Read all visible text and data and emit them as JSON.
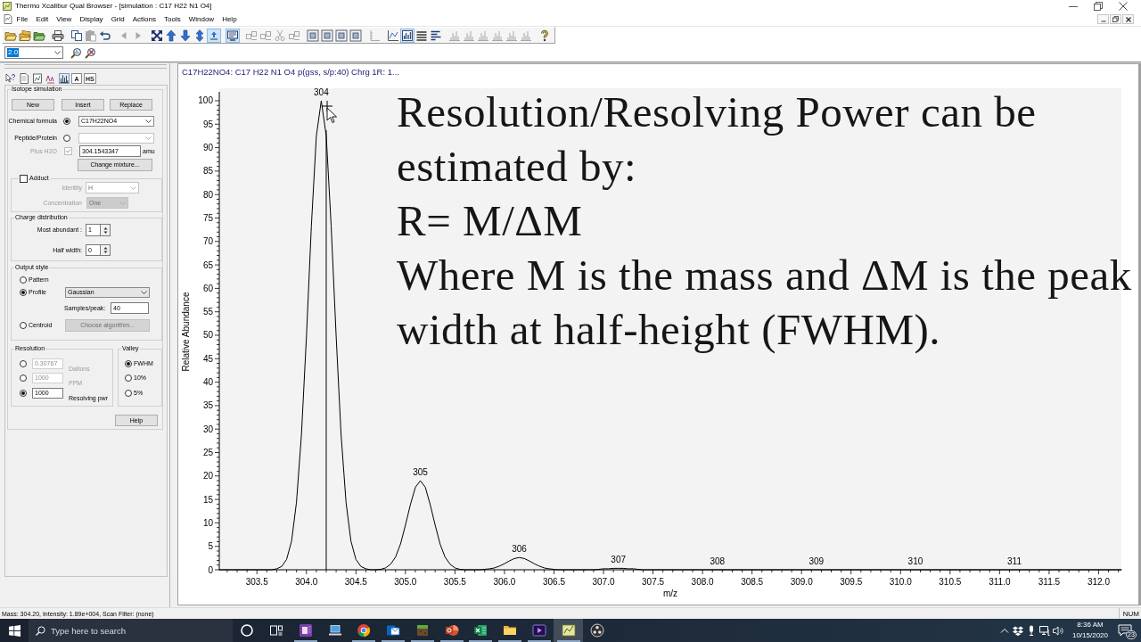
{
  "window": {
    "title": "Thermo Xcalibur Qual Browser - [simulation : C17 H22 N1 O4]"
  },
  "menu": [
    "File",
    "Edit",
    "View",
    "Display",
    "Grid",
    "Actions",
    "Tools",
    "Window",
    "Help"
  ],
  "toolbar": [
    [
      {
        "kind": "open",
        "selected": false,
        "disabled": false
      },
      {
        "kind": "open_stack",
        "selected": false,
        "disabled": false
      },
      {
        "kind": "open_green",
        "selected": false,
        "disabled": false
      }
    ],
    [
      {
        "kind": "print",
        "selected": false,
        "disabled": false
      }
    ],
    [
      {
        "kind": "copy",
        "selected": false,
        "disabled": false
      },
      {
        "kind": "paste",
        "selected": false,
        "disabled": true
      },
      {
        "kind": "undo",
        "selected": false,
        "disabled": false
      }
    ],
    [
      {
        "kind": "back",
        "selected": false,
        "disabled": true
      },
      {
        "kind": "forward",
        "selected": false,
        "disabled": true
      }
    ],
    [
      {
        "kind": "reset",
        "selected": false,
        "disabled": false
      },
      {
        "kind": "up",
        "selected": false,
        "disabled": false
      },
      {
        "kind": "down",
        "selected": false,
        "disabled": false
      },
      {
        "kind": "updown",
        "selected": false,
        "disabled": false
      },
      {
        "kind": "auto",
        "selected": true,
        "disabled": false
      }
    ],
    [
      {
        "kind": "display",
        "selected": true,
        "disabled": false
      }
    ],
    [
      {
        "kind": "cell",
        "selected": false,
        "disabled": true
      },
      {
        "kind": "cell",
        "selected": false,
        "disabled": true
      },
      {
        "kind": "cut",
        "selected": false,
        "disabled": true
      },
      {
        "kind": "cell",
        "selected": false,
        "disabled": true
      }
    ],
    [
      {
        "kind": "frame",
        "selected": false,
        "disabled": false
      },
      {
        "kind": "frame",
        "selected": false,
        "disabled": false
      },
      {
        "kind": "frame",
        "selected": false,
        "disabled": false
      },
      {
        "kind": "frame",
        "selected": false,
        "disabled": false
      }
    ],
    [
      {
        "kind": "ruler",
        "selected": false,
        "disabled": true
      }
    ],
    [
      {
        "kind": "chart",
        "selected": false,
        "disabled": false
      },
      {
        "kind": "bars",
        "selected": true,
        "disabled": false
      },
      {
        "kind": "list",
        "selected": false,
        "disabled": false
      },
      {
        "kind": "lines",
        "selected": false,
        "disabled": false
      }
    ],
    [
      {
        "kind": "peaks",
        "selected": false,
        "disabled": true
      },
      {
        "kind": "peaks",
        "selected": false,
        "disabled": true
      },
      {
        "kind": "peaks",
        "selected": false,
        "disabled": true
      },
      {
        "kind": "peaks",
        "selected": false,
        "disabled": true
      },
      {
        "kind": "peaks",
        "selected": false,
        "disabled": true
      },
      {
        "kind": "peaks",
        "selected": false,
        "disabled": true
      }
    ],
    [
      {
        "kind": "help",
        "selected": false,
        "disabled": false
      }
    ]
  ],
  "zoom_box": {
    "value": "2.0",
    "highlighted": true
  },
  "panel_tabs": [
    {
      "kind": "question",
      "selected": false
    },
    {
      "kind": "page",
      "selected": false
    },
    {
      "kind": "page_chart",
      "selected": false
    },
    {
      "kind": "text_size",
      "selected": false
    },
    {
      "kind": "spectrum",
      "selected": true
    },
    {
      "kind": "letter",
      "label": "A",
      "selected": false
    },
    {
      "kind": "letter",
      "label": "HS",
      "selected": false
    }
  ],
  "isotope_simulation": {
    "title": "Isotope simulation",
    "buttons": [
      "New",
      "Insert",
      "Replace"
    ],
    "formula": {
      "label": "Chemical formula",
      "selected": true,
      "value": "C17H22NO4",
      "kind": "editable",
      "disabled": false
    },
    "peptide": {
      "label": "Peptide/Protein",
      "selected": false,
      "kind": "editable",
      "disabled": true
    },
    "plus_h2o": {
      "label": "Plus H2O",
      "checked": true,
      "disabled": true,
      "value": "304.1543347",
      "unit": "amu"
    },
    "change_mixture": "Change mixture...",
    "adduct": {
      "label": "Adduct",
      "checked": false,
      "fields": [
        {
          "label": "Identity",
          "value": "H",
          "kind": "editable",
          "disabled": true
        },
        {
          "label": "Concentration",
          "value": "One",
          "kind": "list",
          "disabled": true
        }
      ]
    },
    "charge": {
      "title": "Charge distribution",
      "fields": [
        {
          "label": "Most abundant :",
          "value": "1"
        },
        {
          "label": "Half width:",
          "value": "0"
        }
      ]
    },
    "output": {
      "title": "Output style",
      "options": [
        {
          "label": "Pattern",
          "selected": false
        },
        {
          "label": "Profile",
          "selected": true
        },
        {
          "label": "Centroid",
          "selected": false
        }
      ],
      "profile": {
        "value": "Gaussian",
        "kind": "list",
        "disabled": false
      },
      "samples": {
        "label": "Samples/peak:",
        "value": "40"
      },
      "algorithm": {
        "label": "Choose algorithm...",
        "disabled": true
      }
    },
    "resolution": {
      "title": "Resolution",
      "rows": [
        {
          "value": "0.30767",
          "unit": "Daltons",
          "selected": false
        },
        {
          "value": "1000",
          "unit": "PPM",
          "selected": false
        },
        {
          "value": "1000",
          "unit": "Resolving pwr",
          "selected": true
        }
      ]
    },
    "valley": {
      "title": "Valley",
      "options": [
        {
          "label": "FWHM",
          "selected": true
        },
        {
          "label": "10%",
          "selected": false
        },
        {
          "label": "5%",
          "selected": false
        }
      ]
    },
    "help": "Help"
  },
  "chart": {
    "header": "C17H22NO4: C17 H22 N1 O4 p(gss, s/p:40) Chrg 1R: 1...",
    "chart_data": {
      "type": "line",
      "xlabel": "m/z",
      "ylabel": "Relative Abundance",
      "x": [
        303.12,
        303.6,
        303.65,
        303.7,
        303.75,
        303.8,
        303.85,
        303.9,
        303.95,
        304,
        304.05,
        304.1,
        304.15,
        304.2,
        304.25,
        304.3,
        304.35,
        304.4,
        304.45,
        304.5,
        304.55,
        304.6,
        304.65,
        304.7,
        304.75,
        304.8,
        304.85,
        304.9,
        304.95,
        305,
        305.05,
        305.1,
        305.15,
        305.2,
        305.25,
        305.3,
        305.35,
        305.4,
        305.45,
        305.5,
        305.55,
        305.6,
        305.65,
        305.7,
        305.75,
        305.8,
        305.85,
        305.9,
        305.95,
        306,
        306.05,
        306.1,
        306.15,
        306.2,
        306.25,
        306.3,
        306.35,
        306.4,
        306.45,
        306.5,
        306.55,
        306.6,
        306.85,
        306.9,
        306.95,
        307,
        307.05,
        307.1,
        307.15,
        307.2,
        307.25,
        307.3,
        307.35,
        307.4,
        307.45,
        312.23
      ],
      "series": [
        {
          "color": "#000000",
          "values": [
            0,
            0,
            0,
            0.2,
            0.7,
            2.2,
            6.1,
            14.4,
            28.9,
            49.8,
            73.3,
            92.5,
            100,
            92.5,
            73.3,
            49.8,
            28.9,
            14.4,
            6.1,
            2.2,
            0.7,
            0.2,
            0,
            0,
            0.1,
            0.4,
            1.2,
            2.7,
            5.5,
            9.5,
            13.9,
            17.6,
            19,
            17.6,
            13.9,
            9.5,
            5.5,
            2.7,
            1.2,
            0.4,
            0.1,
            0,
            0,
            0,
            0,
            0.1,
            0.2,
            0.4,
            0.8,
            1.3,
            1.9,
            2.4,
            2.6,
            2.4,
            1.9,
            1.3,
            0.8,
            0.4,
            0.2,
            0.1,
            0,
            0,
            0,
            0,
            0.1,
            0.2,
            0.2,
            0.3,
            0.3,
            0.3,
            0.2,
            0.2,
            0.1,
            0,
            0,
            0
          ]
        }
      ],
      "xlim": [
        303.12,
        312.23
      ],
      "ylim": [
        0,
        102.66
      ],
      "xticks": [
        303.5,
        {
          "value": 304,
          "label": "304.0"
        },
        304.5,
        {
          "value": 305,
          "label": "305.0"
        },
        305.5,
        {
          "value": 306,
          "label": "306.0"
        },
        306.5,
        {
          "value": 307,
          "label": "307.0"
        },
        307.5,
        {
          "value": 308,
          "label": "308.0"
        },
        308.5,
        {
          "value": 309,
          "label": "309.0"
        },
        309.5,
        {
          "value": 310,
          "label": "310.0"
        },
        310.5,
        {
          "value": 311,
          "label": "311.0"
        },
        311.5,
        {
          "value": 312,
          "label": "312.0"
        }
      ],
      "yticks": [
        0,
        5,
        10,
        15,
        20,
        25,
        30,
        35,
        40,
        45,
        50,
        55,
        60,
        65,
        70,
        75,
        80,
        85,
        90,
        95,
        100
      ],
      "annotations": [
        {
          "text": "304",
          "x": 304.15,
          "y": 100
        },
        {
          "text": "305",
          "x": 305.15,
          "y": 19
        },
        {
          "text": "306",
          "x": 306.15,
          "y": 2.6
        },
        {
          "text": "307",
          "x": 307.15,
          "y": 0.3
        },
        {
          "text": "308",
          "x": 308.15,
          "y": 0
        },
        {
          "text": "309",
          "x": 309.15,
          "y": 0
        },
        {
          "text": "310",
          "x": 310.15,
          "y": 0
        },
        {
          "text": "311",
          "x": 311.15,
          "y": 0
        }
      ],
      "ref_lines": [
        {
          "axis": "x",
          "value": 304.2
        }
      ]
    },
    "overlay_text": [
      "Resolution/Resolving Power can be estimated by:",
      "R= M/ΔM",
      "Where M is the mass and ΔM is the peak width at half-height (FWHM)."
    ]
  },
  "status_bar": {
    "text": "Mass: 304.20, Intensity: 1.89e+004, Scan Filter: (none)",
    "indicator": "NUM"
  },
  "taskbar": {
    "search": {
      "placeholder": "Type here to search"
    },
    "apps": [
      {
        "kind": "circle",
        "running": false,
        "selected": false
      },
      {
        "kind": "task_view",
        "running": false,
        "selected": false
      },
      {
        "kind": "notebook",
        "running": true,
        "selected": false
      },
      {
        "kind": "laptop",
        "running": false,
        "selected": false
      },
      {
        "kind": "browser",
        "running": true,
        "selected": false
      },
      {
        "kind": "mail",
        "running": true,
        "selected": false
      },
      {
        "kind": "block",
        "running": true,
        "selected": false
      },
      {
        "kind": "slides",
        "running": true,
        "selected": false
      },
      {
        "kind": "sheet",
        "running": true,
        "selected": false
      },
      {
        "kind": "folder",
        "running": true,
        "selected": false
      },
      {
        "kind": "video",
        "running": true,
        "selected": false
      },
      {
        "kind": "chart",
        "running": true,
        "selected": true
      },
      {
        "kind": "record",
        "running": false,
        "selected": false
      }
    ],
    "time": "8:36 AM",
    "date": "10/15/2020",
    "notifications": "23"
  }
}
